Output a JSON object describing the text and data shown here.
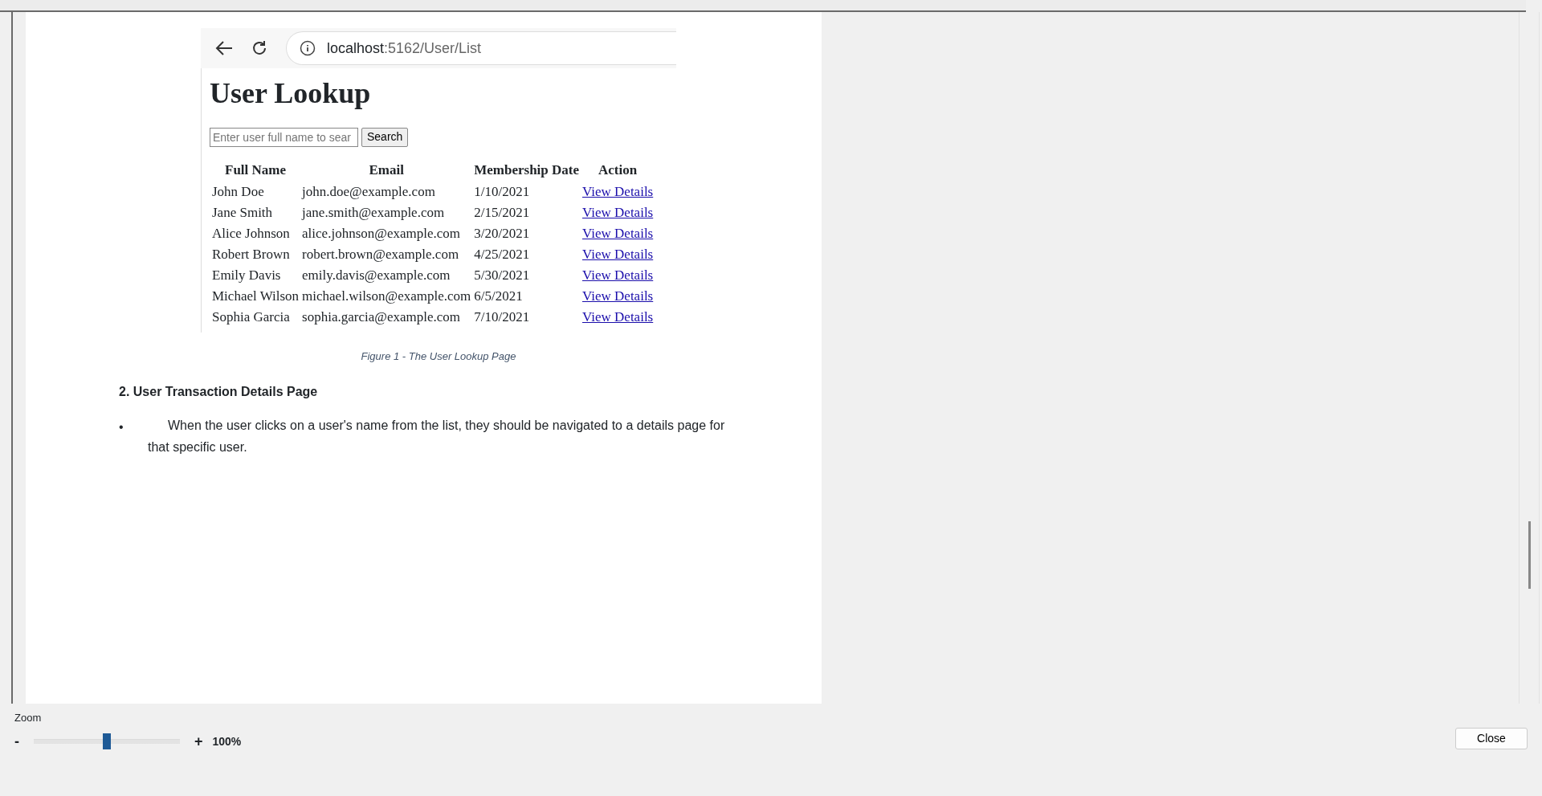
{
  "document": {
    "figure": {
      "browser": {
        "address_host": "localhost",
        "address_path": ":5162/User/List"
      },
      "app": {
        "title": "User Lookup",
        "search": {
          "placeholder": "Enter user full name to sear",
          "button": "Search"
        },
        "table": {
          "columns": [
            "Full Name",
            "Email",
            "Membership Date",
            "Action"
          ],
          "rows": [
            {
              "full_name": "John Doe",
              "email": "john.doe@example.com",
              "membership_date": "1/10/2021",
              "action": "View Details"
            },
            {
              "full_name": "Jane Smith",
              "email": "jane.smith@example.com",
              "membership_date": "2/15/2021",
              "action": "View Details"
            },
            {
              "full_name": "Alice Johnson",
              "email": "alice.johnson@example.com",
              "membership_date": "3/20/2021",
              "action": "View Details"
            },
            {
              "full_name": "Robert Brown",
              "email": "robert.brown@example.com",
              "membership_date": "4/25/2021",
              "action": "View Details"
            },
            {
              "full_name": "Emily Davis",
              "email": "emily.davis@example.com",
              "membership_date": "5/30/2021",
              "action": "View Details"
            },
            {
              "full_name": "Michael Wilson",
              "email": "michael.wilson@example.com",
              "membership_date": "6/5/2021",
              "action": "View Details"
            },
            {
              "full_name": "Sophia Garcia",
              "email": "sophia.garcia@example.com",
              "membership_date": "7/10/2021",
              "action": "View Details"
            }
          ]
        }
      },
      "caption": "Figure 1 - The User Lookup Page"
    },
    "heading": "2. User Transaction Details Page",
    "bullets": [
      {
        "marker": "•",
        "text": "When the user clicks on a user's name from the list, they should be navigated to a details page for that specific user."
      }
    ]
  },
  "zoom": {
    "label": "Zoom",
    "minus": "-",
    "plus": "+",
    "level": 0.5,
    "reading": "100%"
  },
  "close_button": "Close"
}
